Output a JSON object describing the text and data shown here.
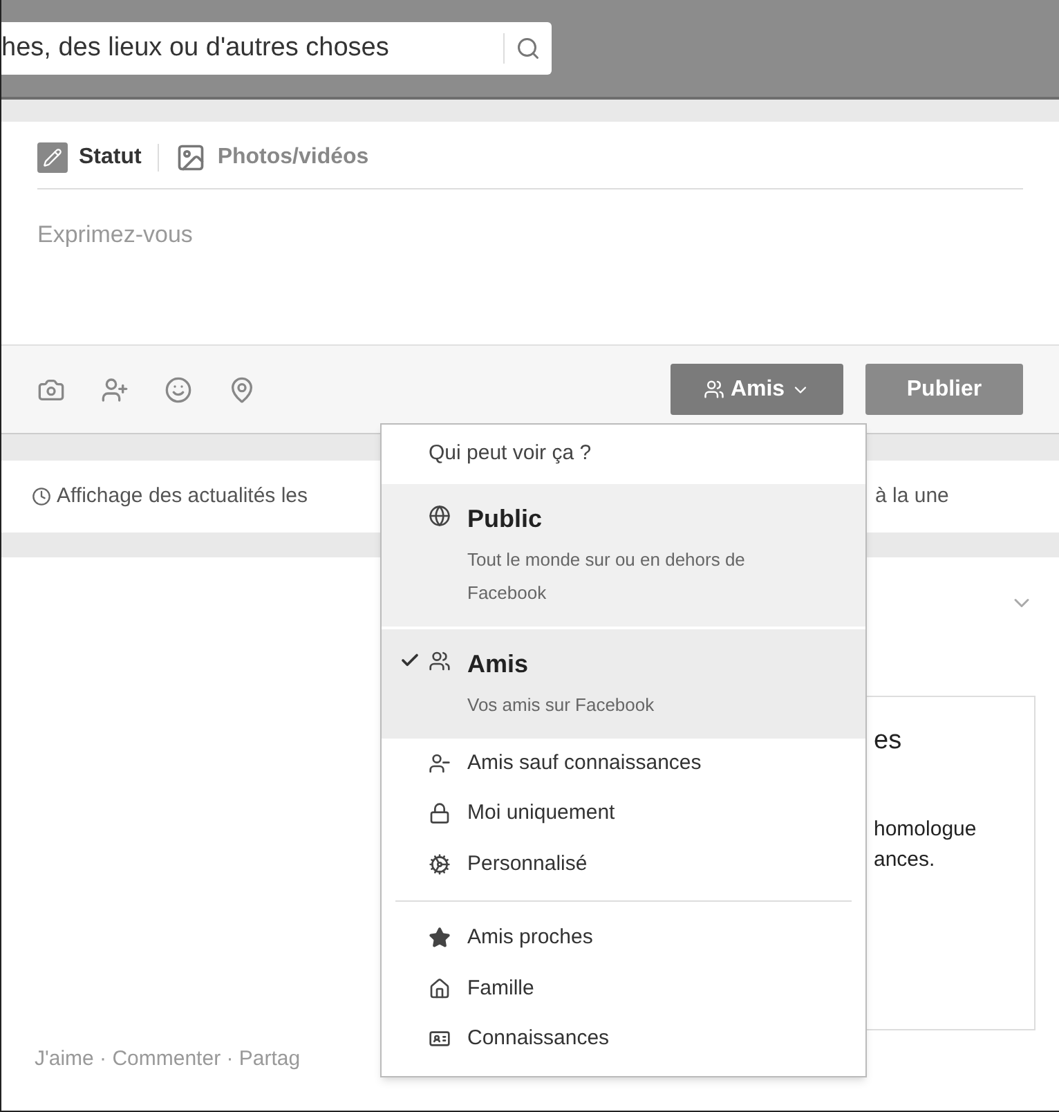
{
  "search": {
    "value": "hes, des lieux ou d'autres choses"
  },
  "composer": {
    "tabs": [
      {
        "label": "Statut",
        "selected": true
      },
      {
        "label": "Photos/vidéos",
        "selected": false
      }
    ],
    "placeholder": "Exprimez-vous",
    "audience_button": "Amis",
    "publish_button": "Publier"
  },
  "news_notice": {
    "text_left": "Affichage des actualités les",
    "text_right": "à la une"
  },
  "post": {
    "card_lines": [
      "es",
      "homologue",
      "ances."
    ],
    "actions": "J'aime · Commenter · Partag"
  },
  "audience_menu": {
    "title": "Qui peut voir ça ?",
    "groups": [
      [
        {
          "kind": "big",
          "label": "Public",
          "description": "Tout le monde sur ou en dehors de Facebook",
          "selected": false,
          "hovered": true
        },
        {
          "kind": "big",
          "label": "Amis",
          "description": "Vos amis sur Facebook",
          "selected": true,
          "hovered": false
        },
        {
          "kind": "small",
          "label": "Amis sauf connaissances",
          "selected": false,
          "hovered": false
        },
        {
          "kind": "small",
          "label": "Moi uniquement",
          "selected": false,
          "hovered": false
        },
        {
          "kind": "small",
          "label": "Personnalisé",
          "selected": false,
          "hovered": false
        }
      ],
      [
        {
          "kind": "small",
          "label": "Amis proches",
          "selected": false,
          "hovered": false
        },
        {
          "kind": "small",
          "label": "Famille",
          "selected": false,
          "hovered": false
        },
        {
          "kind": "small",
          "label": "Connaissances",
          "selected": false,
          "hovered": false
        }
      ]
    ]
  }
}
